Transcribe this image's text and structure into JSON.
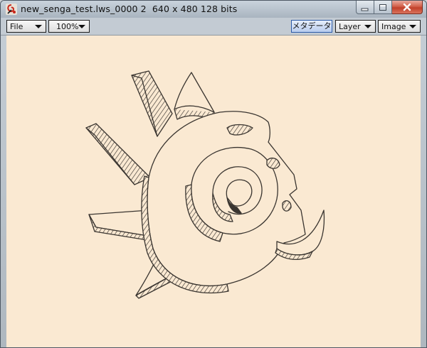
{
  "window": {
    "title": "new_senga_test.lws_0000 2  640 x 480 128 bits",
    "icon": "app-swirl-icon"
  },
  "titlebar_controls": [
    "minimize-icon",
    "maximize-icon",
    "close-icon"
  ],
  "toolbar": {
    "file_menu": "File",
    "zoom_select": "100%",
    "metadata_button": "メタデータ",
    "layer_menu": "Layer",
    "image_menu": "Image"
  },
  "colors": {
    "canvas_background": "#fae9d2",
    "sketch_line": "#3a3530",
    "close_button": "#c8452e"
  }
}
